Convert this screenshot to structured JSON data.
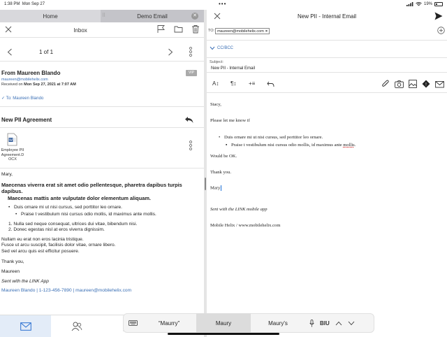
{
  "status": {
    "time": "1:38 PM",
    "date": "Mon Sep 27",
    "dots": "•••",
    "battery": "19%"
  },
  "tabs": [
    {
      "label": "Home"
    },
    {
      "label": "Demo Email"
    }
  ],
  "inbox": {
    "title": "Inbox",
    "pager": "1 of 1",
    "sender_name": "From Maureen Blando",
    "sender_email": "maureen@mobilehelix.com",
    "received_label": "Received on",
    "received_date": "Mon Sep 27, 2021 at 7:07 AM",
    "vip": "VIP",
    "to_line": "To: Maureen Blando",
    "subject": "New PII Agreement",
    "attachment": {
      "name_line1": "Employee PII",
      "name_line2": "Agreement.D",
      "name_line3": "OCX"
    },
    "body": {
      "greeting": "Mary,",
      "bold1": "Maecenas viverra erat sit amet odio pellentesque, pharetra dapibus turpis dapibus.",
      "bold2": "Maecenas mattis ante vulputate dolor elementum aliquam.",
      "bullet1": "Duis ornare mi ut nisi cursus, sed porttitor leo ornare.",
      "subbullet1": "Praise t vestibulum nisi cursus odio mollis, id maximus ante mollis.",
      "num1": "1.  Nulla sed neque consequat, ultrices dui vitae, bibendum nisi.",
      "num2": "2.  Donec egestas nisl at eros viverra dignissim.",
      "line1": "Nullam eu erat non eros lacinia tristique.",
      "line2": "Fusce ut arcu suscipit, facilisis dolor vitae, ornare libero.",
      "line3": "Sed vel arcu quis est efficitur posuere.",
      "thanks": "Thank you,",
      "signname": "Maureen",
      "sent": "Sent with the LINK App",
      "cut": "Maureen Blando | 1-123-456-7890 | maureen@mobilehelix.com"
    }
  },
  "compose": {
    "title": "New PII - Internal Email",
    "to_label": "TO:",
    "to_chip": "maureen@mobilehelix.com",
    "chip_x": "×",
    "cc_label": "CC/BCC",
    "subject_label": "Subject:",
    "subject_value": "New PII - Internal Email",
    "fmt": {
      "a": "A↕",
      "p": "¶↕",
      "i": "+≡"
    },
    "body": {
      "greeting": "Stacy,",
      "line1": "Please let me know if",
      "bullet1": "Duis ornare mi ut nisi cursus, sed porttitor leo ornare.",
      "subbullet_a": "Praise t vestibulum nisi cursus odio mollis, id maximus ante ",
      "subbullet_b": "mollis",
      "subbullet_c": ".",
      "ok": "Would be OK.",
      "thanks": "Thank you.",
      "name": "Mary",
      "sent": "Sent with the LINK mobile app",
      "company": "Mobile Helix / www.mobilehelix.com"
    }
  },
  "keyboard": {
    "suggestions": [
      "“Maurry”",
      "Maury",
      "Maury's"
    ],
    "biu": "BIU"
  },
  "colors": {
    "accent": "#3a6fb5",
    "tab_home": "#d8d8dc",
    "tab_demo": "#c4c4c9"
  }
}
